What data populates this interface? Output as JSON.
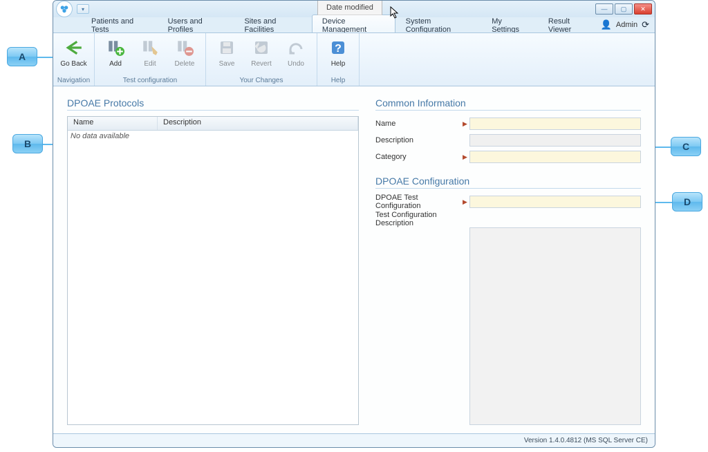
{
  "title_extras": {
    "date_modified": "Date modified"
  },
  "user_label": "Admin",
  "menu_tabs": {
    "patients": "Patients and Tests",
    "users": "Users and Profiles",
    "sites": "Sites and Facilities",
    "device": "Device Management",
    "system": "System Configuration",
    "settings": "My Settings",
    "result": "Result Viewer"
  },
  "ribbon": {
    "groups": {
      "navigation": "Navigation",
      "test_config": "Test configuration",
      "changes": "Your Changes",
      "help": "Help"
    },
    "items": {
      "go_back": "Go Back",
      "add": "Add",
      "edit": "Edit",
      "delete": "Delete",
      "save": "Save",
      "revert": "Revert",
      "undo": "Undo",
      "help": "Help"
    }
  },
  "left": {
    "section_title": "DPOAE Protocols",
    "col_name": "Name",
    "col_desc": "Description",
    "empty_text": "No data available"
  },
  "right": {
    "common_title": "Common Information",
    "name_label": "Name",
    "desc_label": "Description",
    "category_label": "Category",
    "dpoae_title": "DPOAE Configuration",
    "test_config_label": "DPOAE Test Configuration",
    "test_config_desc_label": "Test Configuration Description"
  },
  "status": "Version 1.4.0.4812 (MS SQL Server CE)",
  "callouts": {
    "a": "A",
    "b": "B",
    "c": "C",
    "d": "D"
  }
}
